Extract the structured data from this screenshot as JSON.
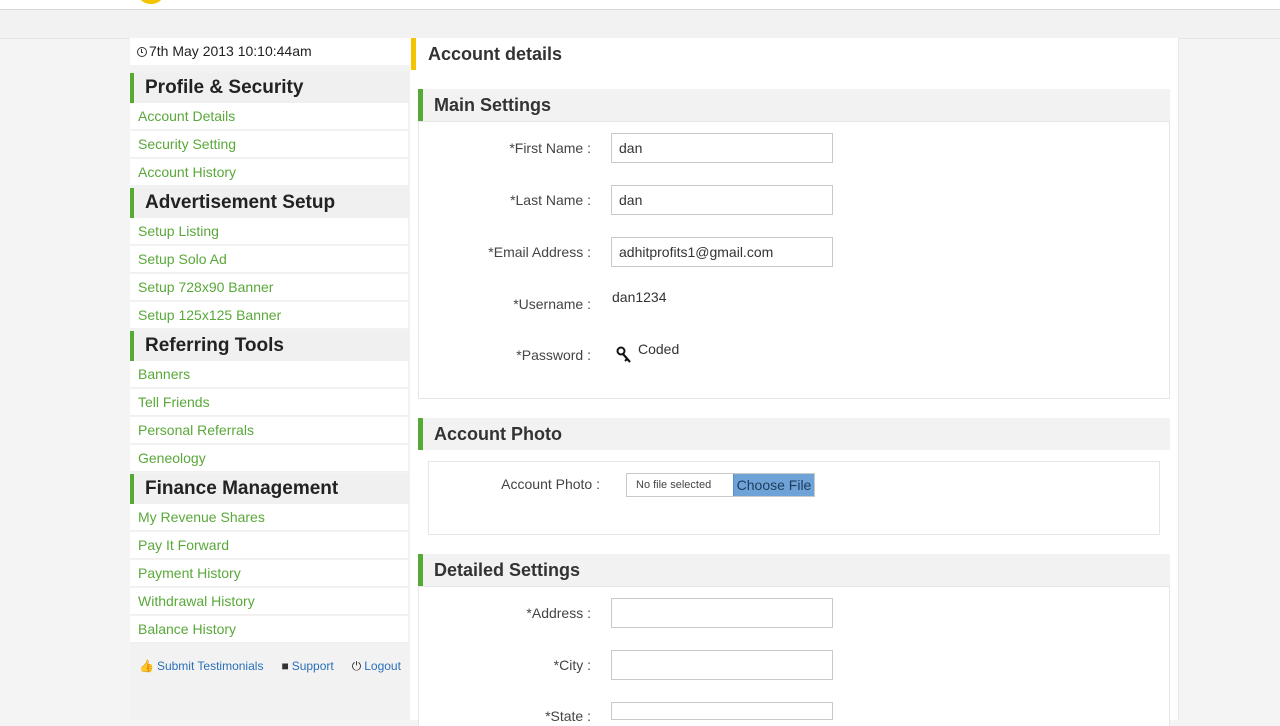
{
  "datetime": "7th May 2013 10:10:44am",
  "sidebar": {
    "sections": [
      {
        "title": "Profile & Security",
        "links": [
          "Account Details",
          "Security Setting",
          "Account History"
        ]
      },
      {
        "title": "Advertisement Setup",
        "links": [
          "Setup Listing",
          "Setup Solo Ad",
          "Setup 728x90 Banner",
          "Setup 125x125 Banner"
        ]
      },
      {
        "title": "Referring Tools",
        "links": [
          "Banners",
          "Tell Friends",
          "Personal Referrals",
          "Geneology"
        ]
      },
      {
        "title": "Finance Management",
        "links": [
          "My Revenue Shares",
          "Pay It Forward",
          "Payment History",
          "Withdrawal History",
          "Balance History"
        ]
      }
    ],
    "footer": {
      "testimonials": "Submit Testimonials",
      "support": "Support",
      "logout": "Logout"
    }
  },
  "main": {
    "title": "Account details",
    "main_settings": {
      "heading": "Main Settings",
      "first_name_label": "*First Name :",
      "first_name_value": "dan",
      "last_name_label": "*Last Name :",
      "last_name_value": "dan",
      "email_label": "*Email Address :",
      "email_value": "adhitprofits1@gmail.com",
      "username_label": "*Username :",
      "username_value": "dan1234",
      "password_label": "*Password :",
      "password_value": "Coded"
    },
    "account_photo": {
      "heading": "Account Photo",
      "label": "Account Photo :",
      "file_status": "No file selected",
      "choose_button": "Choose File"
    },
    "detailed_settings": {
      "heading": "Detailed Settings",
      "address_label": "*Address :",
      "address_value": "",
      "city_label": "*City :",
      "city_value": "",
      "state_label": "*State :",
      "state_value": ""
    }
  },
  "colors": {
    "accent_green": "#55aa33",
    "link_green": "#5aa83a",
    "accent_yellow": "#f5c400",
    "footer_link_blue": "#2a6fb8"
  },
  "icons": [
    "clock-icon",
    "thumbs-up-icon",
    "speech-bubble-icon",
    "power-icon",
    "key-icon"
  ]
}
